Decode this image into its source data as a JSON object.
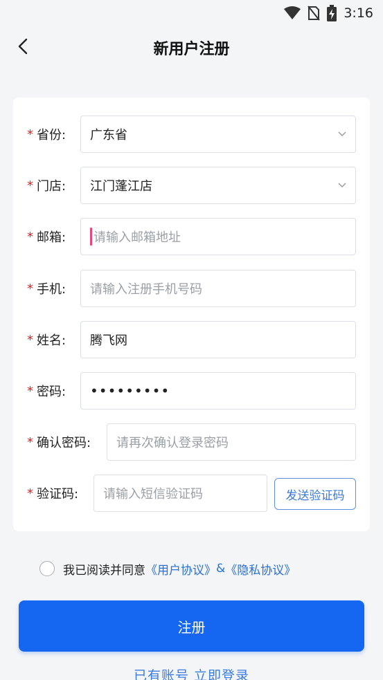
{
  "status_bar": {
    "time": "3:16",
    "icons": [
      "wifi-icon",
      "no-sim-icon",
      "battery-charging-icon"
    ]
  },
  "nav": {
    "title": "新用户注册",
    "back_icon": "chevron-left-icon"
  },
  "form": {
    "required_mark": "*",
    "province": {
      "label": "省份:",
      "value": "广东省"
    },
    "store": {
      "label": "门店:",
      "value": "江门蓬江店"
    },
    "email": {
      "label": "邮箱:",
      "placeholder": "请输入邮箱地址"
    },
    "phone": {
      "label": "手机:",
      "placeholder": "请输入注册手机号码"
    },
    "name": {
      "label": "姓名:",
      "value": "腾飞网"
    },
    "password": {
      "label": "密码:",
      "value": "•••••••••"
    },
    "confirm_password": {
      "label": "确认密码:",
      "placeholder": "请再次确认登录密码"
    },
    "verify_code": {
      "label": "验证码:",
      "placeholder": "请输入短信验证码",
      "send_label": "发送验证码"
    }
  },
  "agreement": {
    "text": "我已阅读并同意",
    "user_agreement": "《用户协议》",
    "amp": "&",
    "privacy_agreement": "《隐私协议》"
  },
  "register_label": "注册",
  "login_link": "已有账号 立即登录",
  "colors": {
    "primary": "#1566f0",
    "link": "#2a6fd6",
    "required": "#e02020",
    "background": "#f4f5f7"
  }
}
